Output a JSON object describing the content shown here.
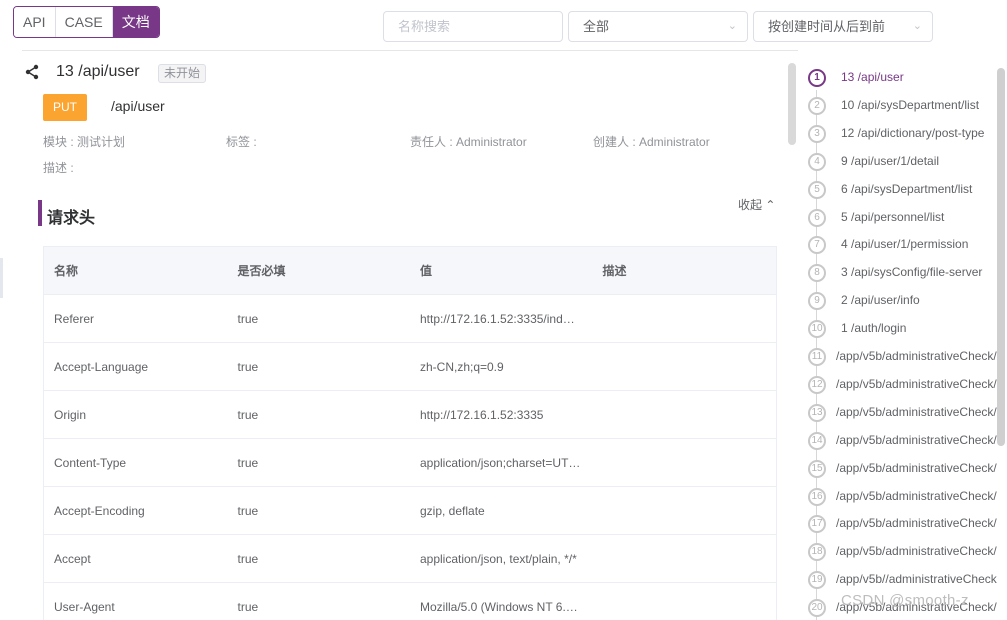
{
  "toolbar": {
    "tabs": [
      {
        "label": "API",
        "active": false
      },
      {
        "label": "CASE",
        "active": false
      },
      {
        "label": "文档",
        "active": true
      }
    ],
    "search_placeholder": "名称搜索",
    "filter_value": "全部",
    "sort_value": "按创建时间从后到前"
  },
  "api": {
    "title": "13 /api/user",
    "status": "未开始",
    "method": "PUT",
    "path": "/api/user",
    "module": "模块 : 测试计划",
    "tags": "标签 :",
    "owner": "责任人 : Administrator",
    "creator": "创建人 : Administrator",
    "description": "描述 :"
  },
  "section": {
    "title": "请求头",
    "collapse_label": "收起"
  },
  "headers_table": {
    "columns": [
      "名称",
      "是否必填",
      "值",
      "描述"
    ],
    "rows": [
      {
        "name": "Referer",
        "required": "true",
        "value": "http://172.16.1.52:3335/ind…",
        "desc": ""
      },
      {
        "name": "Accept-Language",
        "required": "true",
        "value": "zh-CN,zh;q=0.9",
        "desc": ""
      },
      {
        "name": "Origin",
        "required": "true",
        "value": "http://172.16.1.52:3335",
        "desc": ""
      },
      {
        "name": "Content-Type",
        "required": "true",
        "value": "application/json;charset=UT…",
        "desc": ""
      },
      {
        "name": "Accept-Encoding",
        "required": "true",
        "value": "gzip, deflate",
        "desc": ""
      },
      {
        "name": "Accept",
        "required": "true",
        "value": "application/json, text/plain, */*",
        "desc": ""
      },
      {
        "name": "User-Agent",
        "required": "true",
        "value": "Mozilla/5.0 (Windows NT 6.…",
        "desc": ""
      }
    ]
  },
  "timeline": [
    {
      "num": "1",
      "label": "13 /api/user",
      "active": true
    },
    {
      "num": "2",
      "label": "10 /api/sysDepartment/list"
    },
    {
      "num": "3",
      "label": "12 /api/dictionary/post-type"
    },
    {
      "num": "4",
      "label": "9 /api/user/1/detail"
    },
    {
      "num": "5",
      "label": "6 /api/sysDepartment/list"
    },
    {
      "num": "6",
      "label": "5 /api/personnel/list"
    },
    {
      "num": "7",
      "label": "4 /api/user/1/permission"
    },
    {
      "num": "8",
      "label": "3 /api/sysConfig/file-server"
    },
    {
      "num": "9",
      "label": "2 /api/user/info"
    },
    {
      "num": "10",
      "label": "1 /auth/login"
    },
    {
      "num": "11",
      "label": "/app/v5b/administrativeCheck/"
    },
    {
      "num": "12",
      "label": "/app/v5b/administrativeCheck/"
    },
    {
      "num": "13",
      "label": "/app/v5b/administrativeCheck/"
    },
    {
      "num": "14",
      "label": "/app/v5b/administrativeCheck/"
    },
    {
      "num": "15",
      "label": "/app/v5b/administrativeCheck/"
    },
    {
      "num": "16",
      "label": "/app/v5b/administrativeCheck/"
    },
    {
      "num": "17",
      "label": "/app/v5b/administrativeCheck/"
    },
    {
      "num": "18",
      "label": "/app/v5b/administrativeCheck/"
    },
    {
      "num": "19",
      "label": "/app/v5b//administrativeCheck"
    },
    {
      "num": "20",
      "label": "/app/v5b/administrativeCheck/"
    }
  ],
  "watermark": "CSDN @smooth-z",
  "colors": {
    "accent": "#783887",
    "put_method": "#fba430"
  }
}
